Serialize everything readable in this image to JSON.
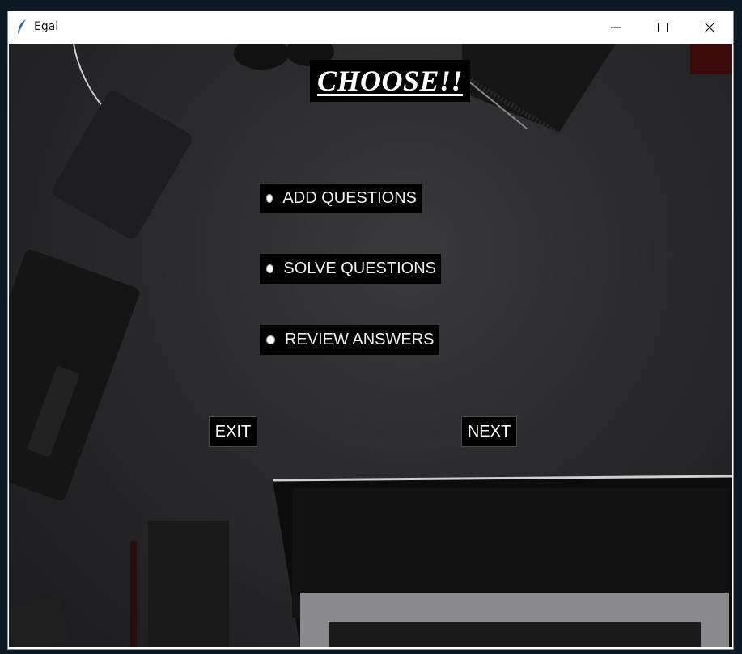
{
  "window": {
    "title": "Egal",
    "app_icon": "feather-icon",
    "controls": {
      "minimize": "minimize-icon",
      "maximize": "maximize-icon",
      "close": "close-icon"
    }
  },
  "main": {
    "heading": "CHOOSE!!",
    "options": [
      {
        "label": "ADD QUESTIONS"
      },
      {
        "label": "SOLVE QUESTIONS"
      },
      {
        "label": "REVIEW ANSWERS"
      }
    ],
    "buttons": {
      "exit": "EXIT",
      "next": "NEXT"
    }
  }
}
